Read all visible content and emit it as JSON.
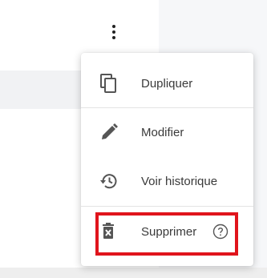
{
  "menu_trigger": {
    "icon": "more-vertical-icon"
  },
  "menu": {
    "items": [
      {
        "label": "Dupliquer",
        "icon": "copy-icon"
      },
      {
        "label": "Modifier",
        "icon": "pencil-icon"
      },
      {
        "label": "Voir historique",
        "icon": "history-icon"
      },
      {
        "label": "Supprimer",
        "icon": "trash-icon",
        "help_icon": "help-circle-icon"
      }
    ]
  },
  "colors": {
    "highlight": "#e0141c",
    "icon": "#555555",
    "text": "#3a3a3a"
  }
}
